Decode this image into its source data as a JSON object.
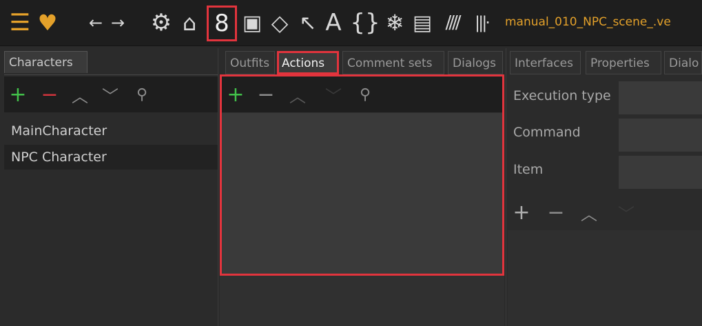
{
  "toolbar": {
    "project_title": "manual_010_NPC_scene_.ve",
    "icons": [
      "menu-icon",
      "logo-icon",
      "back-arrow-icon",
      "forward-arrow-icon",
      "gear-icon",
      "home-icon",
      "character-icon",
      "dialog-icon",
      "gem-icon",
      "cursor-icon",
      "font-icon",
      "braces-icon",
      "snowflake-icon",
      "chat-icon",
      "stripes-icon",
      "audio-icon"
    ]
  },
  "left_panel": {
    "tab_label": "Characters",
    "items": [
      "MainCharacter",
      "NPC Character"
    ],
    "selected_index": 1
  },
  "middle_tabs": [
    "Outfits",
    "Actions",
    "Comment sets",
    "Dialogs"
  ],
  "active_middle_tab": "Actions",
  "right_tabs": [
    "Interfaces",
    "Properties",
    "Dialo"
  ],
  "right_panel": {
    "fields": [
      {
        "label": "Execution type",
        "value": ""
      },
      {
        "label": "Command",
        "value": ""
      },
      {
        "label": "Item",
        "value": ""
      }
    ]
  },
  "colors": {
    "accent": "#e4a12a",
    "highlight": "#e2343d",
    "add": "#42c14a",
    "remove": "#d0343c",
    "background": "#2b2b2b",
    "toolbar": "#1e1e1e"
  }
}
